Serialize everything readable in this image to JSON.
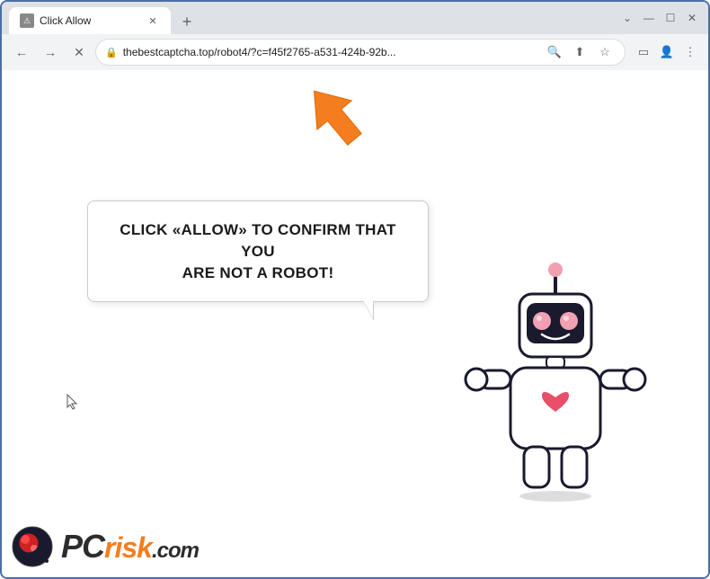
{
  "browser": {
    "tab": {
      "title": "Click Allow",
      "favicon": "⚠"
    },
    "new_tab_label": "+",
    "window_controls": {
      "minimize": "—",
      "maximize": "☐",
      "close": "✕"
    },
    "nav": {
      "back": "←",
      "forward": "→",
      "reload": "✕",
      "url": "thebestcaptcha.top/robot4/?c=f45f2765-a531-424b-92b...",
      "lock": "🔒"
    }
  },
  "page": {
    "bubble_text_line1": "CLICK «ALLOW» TO CONFIRM THAT YOU",
    "bubble_text_line2": "ARE NOT A ROBOT!"
  },
  "watermark": {
    "text_pc": "PC",
    "text_risk": "risk",
    "text_com": ".com"
  }
}
